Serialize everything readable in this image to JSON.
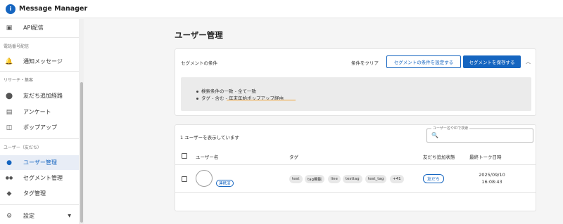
{
  "app": {
    "title": "Message Manager",
    "logo_char": "i"
  },
  "sidebar": {
    "api": {
      "label": "API配信",
      "icon": "terminal-icon",
      "icon_char": "▣"
    },
    "sec_phone": "電話番号配信",
    "notify": {
      "label": "通知メッセージ",
      "icon": "bell-icon",
      "icon_char": "🔔"
    },
    "sec_research": "リサーチ・集客",
    "route": {
      "label": "友だち追加経路",
      "icon": "location-icon",
      "icon_char": "⬤"
    },
    "survey": {
      "label": "アンケート",
      "icon": "clipboard-icon",
      "icon_char": "▤"
    },
    "popup": {
      "label": "ポップアップ",
      "icon": "popup-icon",
      "icon_char": "◫"
    },
    "sec_users": "ユーザー（友だち）",
    "users": {
      "label": "ユーザー管理",
      "icon": "person-icon",
      "icon_char": "●"
    },
    "segments": {
      "label": "セグメント管理",
      "icon": "people-icon",
      "icon_char": "●●"
    },
    "tags": {
      "label": "タグ管理",
      "icon": "tag-icon",
      "icon_char": "◆"
    },
    "settings": {
      "label": "設定",
      "icon": "gear-icon",
      "icon_char": "⚙",
      "caret_char": "▼"
    }
  },
  "main": {
    "title": "ユーザー管理",
    "segment": {
      "title": "セグメントの条件",
      "clear_label": "条件をクリア",
      "set_button": "セグメントの条件を設定する",
      "save_button": "セグメントを保存する",
      "collapse_char": "︿",
      "conditions": [
        "検索条件の一致 - 全て一致",
        "タグ - 含む - 年末年始ポップアップ経由"
      ]
    },
    "users": {
      "count_text": "1 ユーザーを表示しています",
      "search_placeholder": "ユーザー名やIDで検索",
      "search_icon_char": "🔍",
      "columns": {
        "name": "ユーザー名",
        "tags": "タグ",
        "friend_status": "友だち追加状態",
        "last_talk": "最終トーク日時"
      },
      "rows": [
        {
          "status_chip": "連携済",
          "tags": [
            "test",
            "tag機能",
            "line",
            "testtag",
            "test_tag",
            "+41"
          ],
          "friend_status": "友だち",
          "last_talk_date": "2025/09/10",
          "last_talk_time": "16:08:43"
        }
      ]
    }
  },
  "colors": {
    "accent": "#1565c0",
    "highlight": "#f0a030"
  }
}
